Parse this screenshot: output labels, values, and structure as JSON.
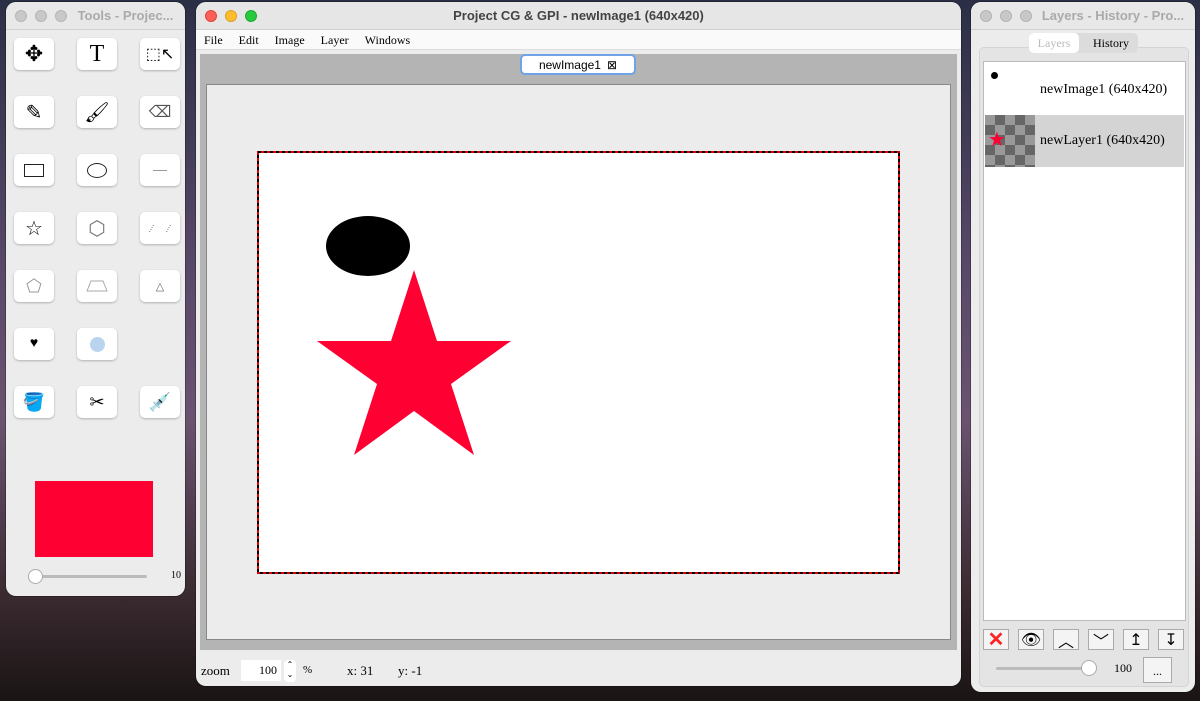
{
  "tools_window": {
    "title": "Tools - Projec...",
    "tools": [
      "move",
      "text",
      "select",
      "pencil",
      "brush",
      "eraser",
      "rectangle",
      "ellipse",
      "line",
      "star",
      "hexagon",
      "parallelogram",
      "pentagon",
      "trapezoid",
      "triangle",
      "heart",
      "circle-slash",
      "bucket",
      "cut",
      "eyedropper"
    ],
    "color": "#ff0033",
    "size_value": "10",
    "size_fraction": 0.1
  },
  "main_window": {
    "title": "Project CG & GPI - newImage1 (640x420)",
    "menu": [
      "File",
      "Edit",
      "Image",
      "Layer",
      "Windows"
    ],
    "tab_label": "newImage1",
    "tab_close": "⊠",
    "zoom_label": "zoom",
    "zoom_value": "100",
    "zoom_unit": "%",
    "x_readout": "x: 31",
    "y_readout": "y: -1",
    "shapes": {
      "ellipse_color": "#000000",
      "star_color": "#ff0033"
    }
  },
  "layers_window": {
    "title": "Layers - History - Pro...",
    "tabs": [
      "Layers",
      "History"
    ],
    "layers": [
      {
        "name": "newImage1 (640x420)"
      },
      {
        "name": "newLayer1 (640x420)",
        "selected": true
      }
    ],
    "opacity_value": "100",
    "opacity_fraction": 1.0,
    "more_label": "..."
  }
}
